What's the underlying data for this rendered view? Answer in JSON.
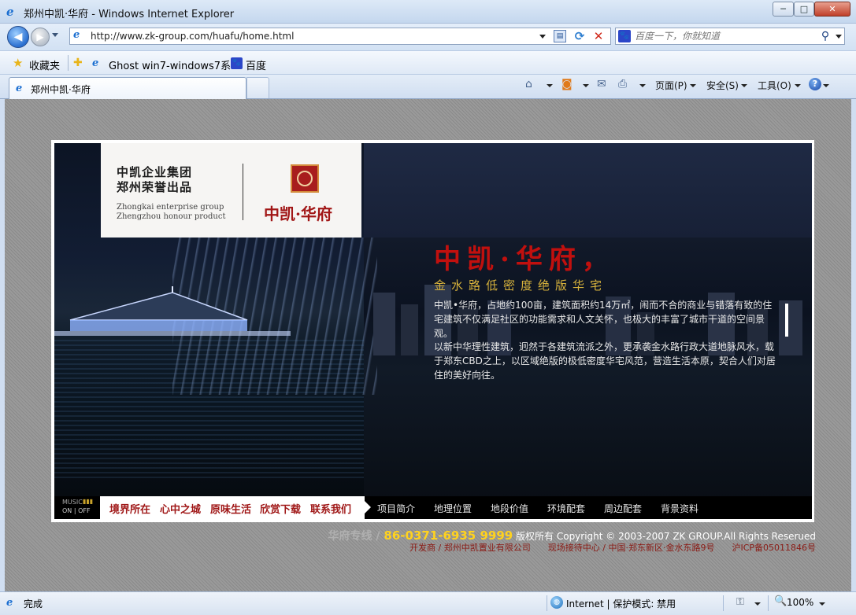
{
  "window": {
    "title": "郑州中凯·华府 - Windows Internet Explorer",
    "minimize": "─",
    "maximize": "□",
    "close": "✕"
  },
  "address": {
    "url": "http://www.zk-group.com/huafu/home.html"
  },
  "search": {
    "placeholder": "百度一下，你就知道",
    "engine_icon": "baidu-paw-icon"
  },
  "favorites": {
    "label": "收藏夹",
    "items": [
      {
        "label": "Ghost win7-windows7系...",
        "icon": "ie-page-icon"
      },
      {
        "label": "百度",
        "icon": "baidu-paw-icon"
      }
    ]
  },
  "tab": {
    "label": "郑州中凯·华府"
  },
  "commandbar": {
    "page": "页面(P)",
    "safety": "安全(S)",
    "tools": "工具(O)"
  },
  "site": {
    "logo": {
      "line1": "中凯企业集团",
      "line2": "郑州荣誉出品",
      "en1": "Zhongkai enterprise group",
      "en2": "Zhengzhou honour product",
      "brand": "中凯·华府"
    },
    "headline": "中凯·华府，",
    "subheadline": "金水路低密度绝版华宅",
    "desc1": "中凯•华府，占地约100亩，建筑面积约14万㎡，闹而不合的商业与错落有致的住宅建筑不仅满足社区的功能需求和人文关怀，也极大的丰富了城市干道的空间景观。",
    "desc2": "以新中华理性建筑，迥然于各建筑流派之外，更承袭金水路行政大道地脉风水，载于郑东CBD之上，以区域绝版的极低密度华宅风范，营造生活本原，契合人们对居住的美好向往。",
    "music": {
      "label": "MUSIC",
      "onoff": "ON | OFF"
    },
    "nav_primary": [
      "境界所在",
      "心中之城",
      "原味生活",
      "欣赏下载",
      "联系我们"
    ],
    "nav_secondary": [
      "项目简介",
      "地理位置",
      "地段价值",
      "环境配套",
      "周边配套",
      "背景资料"
    ],
    "footer": {
      "hotline_label": "华府专线 / ",
      "phone": "86-0371-6935 9999",
      "copyright": "版权所有 Copyright © 2003-2007 ZK GROUP.All Rights Reserued",
      "line2": "开发商 / 郑州中凯置业有限公司　　现场接待中心 / 中国·郑东新区·金水东路9号　　沪ICP备05011846号"
    }
  },
  "status": {
    "text": "完成",
    "zone": "Internet | 保护模式: 禁用",
    "zoom": "100%"
  }
}
